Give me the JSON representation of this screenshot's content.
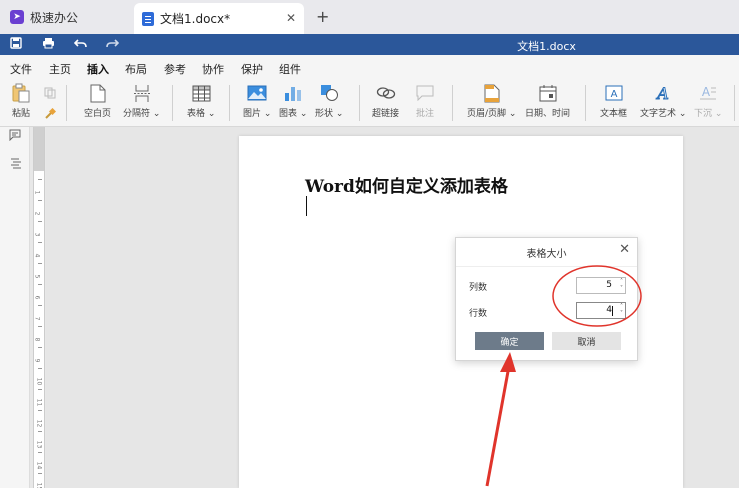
{
  "tabs": {
    "app_label": "极速办公",
    "doc_label": "文档1.docx*",
    "close_glyph": "✕",
    "new_tab_glyph": "+"
  },
  "titlebar": {
    "title": "文档1.docx",
    "icons": [
      "save-icon",
      "print-icon",
      "undo-icon",
      "redo-icon"
    ]
  },
  "menu": {
    "items": [
      "文件",
      "主页",
      "插入",
      "布局",
      "参考",
      "协作",
      "保护",
      "组件"
    ],
    "active": "插入"
  },
  "ribbon": {
    "paste": "粘贴",
    "blank_page": "空白页",
    "break": "分隔符",
    "table": "表格",
    "picture": "图片",
    "chart": "图表",
    "shape": "形状",
    "hyperlink": "超链接",
    "comment": "批注",
    "header_footer": "页眉/页脚",
    "datetime": "日期、时间",
    "textbox": "文本框",
    "wordart": "文字艺术",
    "dropcap": "下沉"
  },
  "document": {
    "title": "Word如何自定义添加表格"
  },
  "dialog": {
    "title": "表格大小",
    "columns_label": "列数",
    "columns_value": "5",
    "rows_label": "行数",
    "rows_value": "4",
    "ok_label": "确定",
    "cancel_label": "取消"
  },
  "ruler": {
    "numbers": [
      "1",
      "2",
      "3",
      "4",
      "5",
      "6",
      "7",
      "8",
      "9",
      "10",
      "11",
      "12",
      "13",
      "14",
      "15"
    ]
  },
  "colors": {
    "titlebar": "#2b579a",
    "annotation": "#e0342b",
    "ok_button": "#6d7b8a"
  }
}
